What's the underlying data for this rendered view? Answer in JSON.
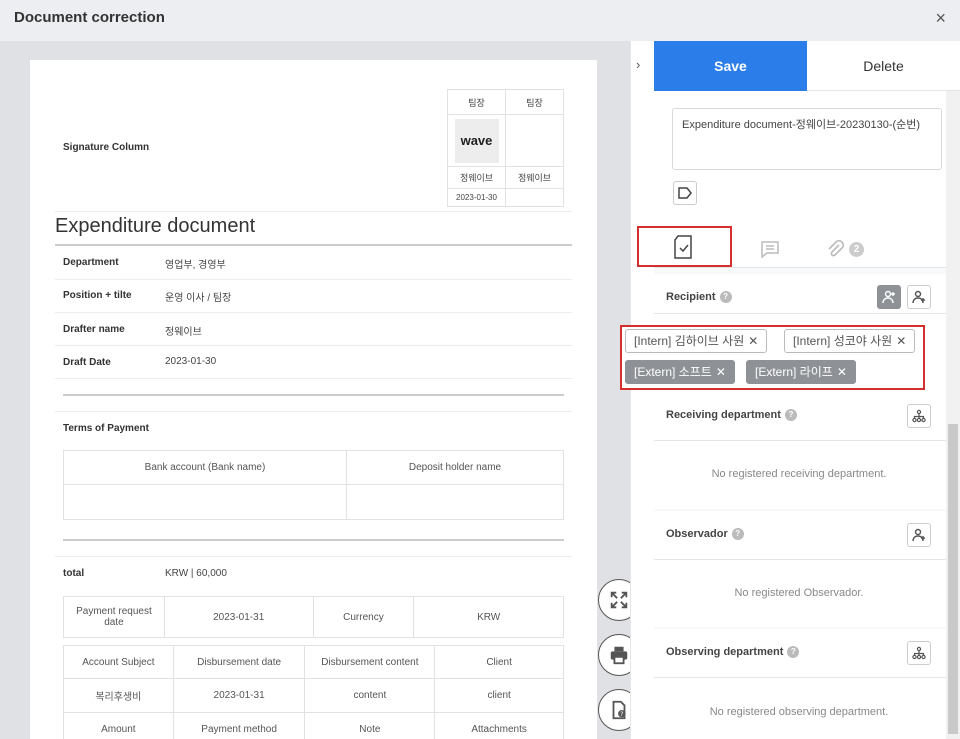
{
  "window": {
    "title": "Document correction",
    "close": "×"
  },
  "signature": {
    "label": "Signature Column",
    "headers": [
      "팀장",
      "팀장"
    ],
    "logo": "wave",
    "names": [
      "정웨이브",
      "정웨이브"
    ],
    "dates": [
      "2023-01-30",
      ""
    ]
  },
  "document": {
    "title": "Expenditure document",
    "fields": [
      {
        "label": "Department",
        "value": "영업부, 경영부"
      },
      {
        "label": "Position + tilte",
        "value": "운영 이사 / 팀장"
      },
      {
        "label": "Drafter name",
        "value": "정웨이브"
      },
      {
        "label": "Draft Date",
        "value": "2023-01-30"
      }
    ],
    "terms_label": "Terms of Payment",
    "bank_headers": [
      "Bank account (Bank name)",
      "Deposit holder name"
    ],
    "total_label": "total",
    "total_value": "KRW | 60,000",
    "payment_row": [
      "Payment request date",
      "2023-01-31",
      "Currency",
      "KRW"
    ],
    "account_headers": [
      "Account Subject",
      "Disbursement date",
      "Disbursement content",
      "Client"
    ],
    "account_row": [
      "복리후생비",
      "2023-01-31",
      "content",
      "client"
    ],
    "amount_headers": [
      "Amount",
      "Payment method",
      "Note",
      "Attachments"
    ]
  },
  "panel": {
    "save": "Save",
    "delete": "Delete",
    "doc_name": "Expenditure document-정웨이브-20230130-(순번)",
    "tabs": {
      "attach_count": "2"
    },
    "recipient": {
      "label": "Recipient",
      "help": "?",
      "tags": [
        "[Intern] 김하이브 사원",
        "[Intern] 성코야 사원",
        "[Extern] 소프트",
        "[Extern] 라이프"
      ],
      "remove": "✕"
    },
    "receiving": {
      "label": "Receiving department",
      "help": "?",
      "empty": "No registered receiving department."
    },
    "observador": {
      "label": "Observador",
      "help": "?",
      "empty": "No registered Observador."
    },
    "observing": {
      "label": "Observing department",
      "help": "?",
      "empty": "No registered observing department."
    }
  },
  "nav": {
    "chevron": "›"
  }
}
